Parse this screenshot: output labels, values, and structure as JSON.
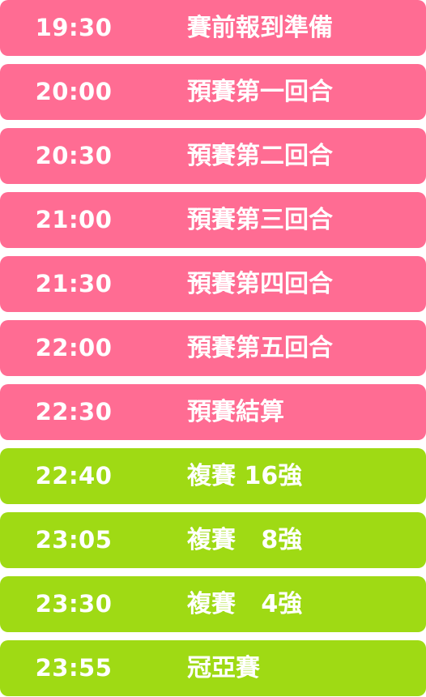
{
  "schedule": {
    "rows": [
      {
        "time": "19:30",
        "event": "賽前報到準備",
        "color": "#ff6c93"
      },
      {
        "time": "20:00",
        "event": "預賽第一回合",
        "color": "#ff6c93"
      },
      {
        "time": "20:30",
        "event": "預賽第二回合",
        "color": "#ff6c93"
      },
      {
        "time": "21:00",
        "event": "預賽第三回合",
        "color": "#ff6c93"
      },
      {
        "time": "21:30",
        "event": "預賽第四回合",
        "color": "#ff6c93"
      },
      {
        "time": "22:00",
        "event": "預賽第五回合",
        "color": "#ff6c93"
      },
      {
        "time": "22:30",
        "event": "預賽結算",
        "color": "#ff6c93"
      },
      {
        "time": "22:40",
        "event": "複賽 16強",
        "color": "#9fda14"
      },
      {
        "time": "23:05",
        "event": "複賽   8強",
        "color": "#9fda14"
      },
      {
        "time": "23:30",
        "event": "複賽   4強",
        "color": "#9fda14"
      },
      {
        "time": "23:55",
        "event": "冠亞賽",
        "color": "#9fda14"
      }
    ]
  }
}
